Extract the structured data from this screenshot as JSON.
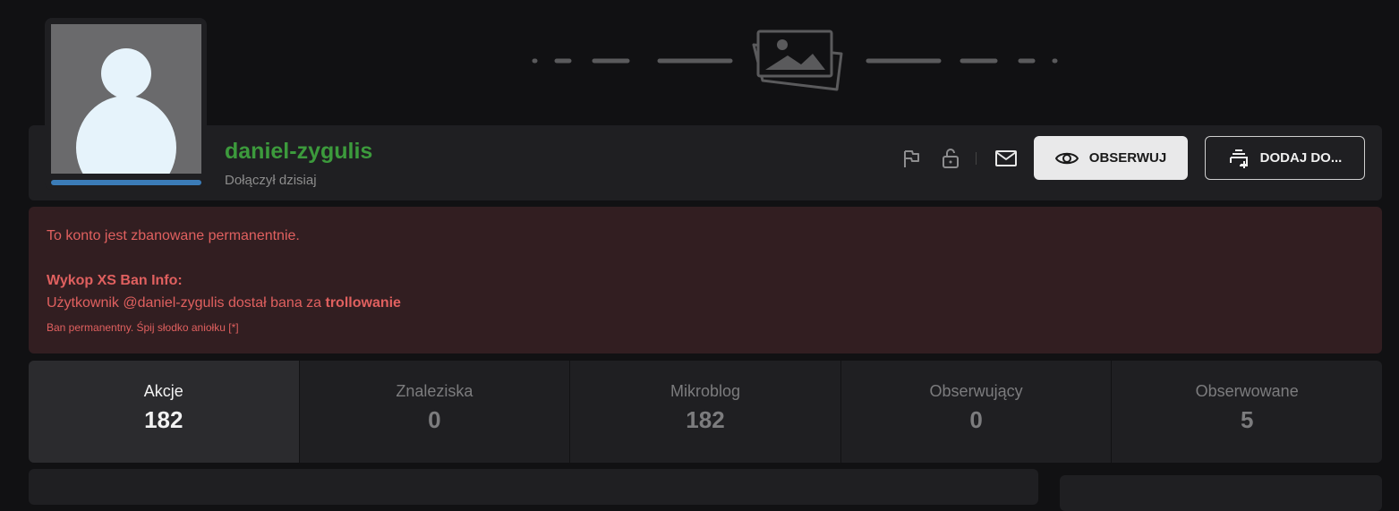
{
  "profile": {
    "username": "daniel-zygulis",
    "joined": "Dołączył dzisiaj",
    "username_color": "#3c9a3c",
    "avatar_icon": "default-avatar-icon",
    "cover_icon": "image-placeholder-icon"
  },
  "actions": {
    "report_icon": "flag-icon",
    "lock_icon": "unlock-icon",
    "message_icon": "envelope-icon",
    "follow_label": "OBSERWUJ",
    "follow_icon": "eye-icon",
    "add_label": "DODAJ DO...",
    "add_icon": "add-to-list-icon"
  },
  "ban": {
    "status": "To konto jest zbanowane permanentnie.",
    "info_title": "Wykop XS Ban Info:",
    "reason_prefix": "Użytkownik @daniel-zygulis dostał bana za ",
    "reason": "trollowanie",
    "note": "Ban permanentny. Śpij słodko aniołku [*]",
    "color": "#e0605f"
  },
  "stats": [
    {
      "label": "Akcje",
      "value": "182",
      "active": true
    },
    {
      "label": "Znaleziska",
      "value": "0",
      "active": false
    },
    {
      "label": "Mikroblog",
      "value": "182",
      "active": false
    },
    {
      "label": "Obserwujący",
      "value": "0",
      "active": false
    },
    {
      "label": "Obserwowane",
      "value": "5",
      "active": false
    }
  ]
}
